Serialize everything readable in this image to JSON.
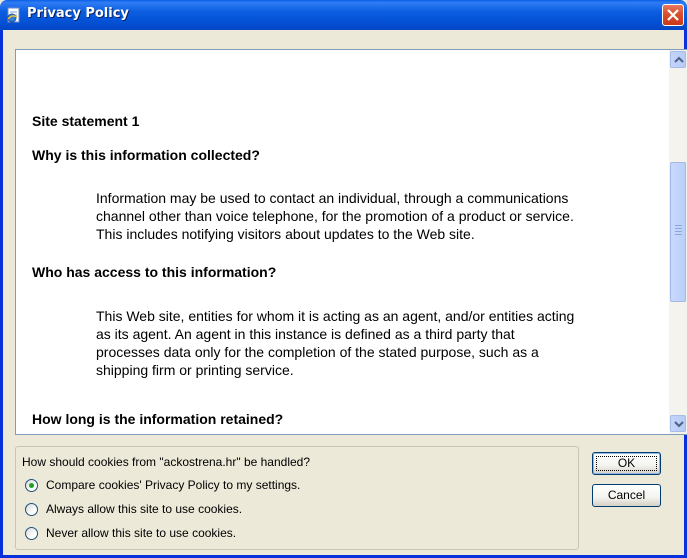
{
  "window": {
    "title": "Privacy Policy"
  },
  "content": {
    "statement_heading": "Site statement 1",
    "sections": [
      {
        "question": "Why is this information collected?",
        "answer_lines": [
          "Information may be used to contact an individual, through a communications",
          "channel other than voice telephone, for the promotion of a product or service.",
          "This includes notifying visitors about updates to the Web site."
        ]
      },
      {
        "question": "Who has access to this information?",
        "answer_lines": [
          "This Web site, entities for whom it is acting as an agent, and/or entities acting",
          "as its agent. An agent in this instance is defined as a third party that",
          "processes data only for the completion of the stated purpose, such as a",
          "shipping firm or printing service."
        ]
      },
      {
        "question": "How long is the information retained?"
      }
    ]
  },
  "cookies": {
    "question": "How should cookies from \"ackostrena.hr\" be handled?",
    "options": [
      {
        "label": "Compare cookies' Privacy Policy to my settings.",
        "selected": true
      },
      {
        "label": "Always allow this site to use cookies.",
        "selected": false
      },
      {
        "label": "Never allow this site to use cookies.",
        "selected": false
      }
    ]
  },
  "buttons": {
    "ok": "OK",
    "cancel": "Cancel"
  },
  "colors": {
    "titlebar": "#0552d6",
    "window_border": "#0831d9",
    "dialog_bg": "#ece9d8",
    "close_button": "#d9502c",
    "radio_selected": "#21a121"
  },
  "icons": {
    "title": "ie-page-icon",
    "close": "close-icon",
    "scroll_up": "arrow-up-icon",
    "scroll_down": "arrow-down-icon"
  }
}
